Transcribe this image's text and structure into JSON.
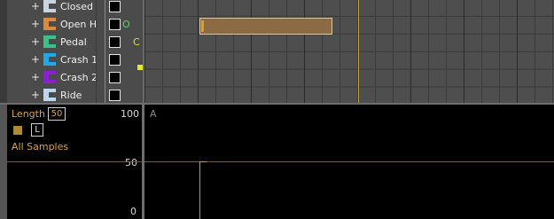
{
  "tracks": [
    {
      "name": "Closed",
      "color": "#c9d4e2",
      "indicator": ""
    },
    {
      "name": "Open H",
      "color": "#d98a3c",
      "indicator": "O"
    },
    {
      "name": "Pedal",
      "color": "#3cc08a",
      "indicator": "C"
    },
    {
      "name": "Crash 1",
      "color": "#1fa9e6",
      "indicator": ""
    },
    {
      "name": "Crash 2",
      "color": "#8a1fd6",
      "indicator": ""
    },
    {
      "name": "Ride",
      "color": "#bcd8f0",
      "indicator": ""
    }
  ],
  "expand_symbol": "+",
  "params": {
    "length_label": "Length",
    "length_value": "50",
    "l_button": "L",
    "samples_label": "All Samples",
    "scale_top": "100",
    "scale_mid": "50",
    "scale_bottom": "0"
  },
  "envelope": {
    "label": "A"
  },
  "colors": {
    "accent": "#d9a53a",
    "note_block": "#8c6a44",
    "playhead": "#bba23d"
  }
}
